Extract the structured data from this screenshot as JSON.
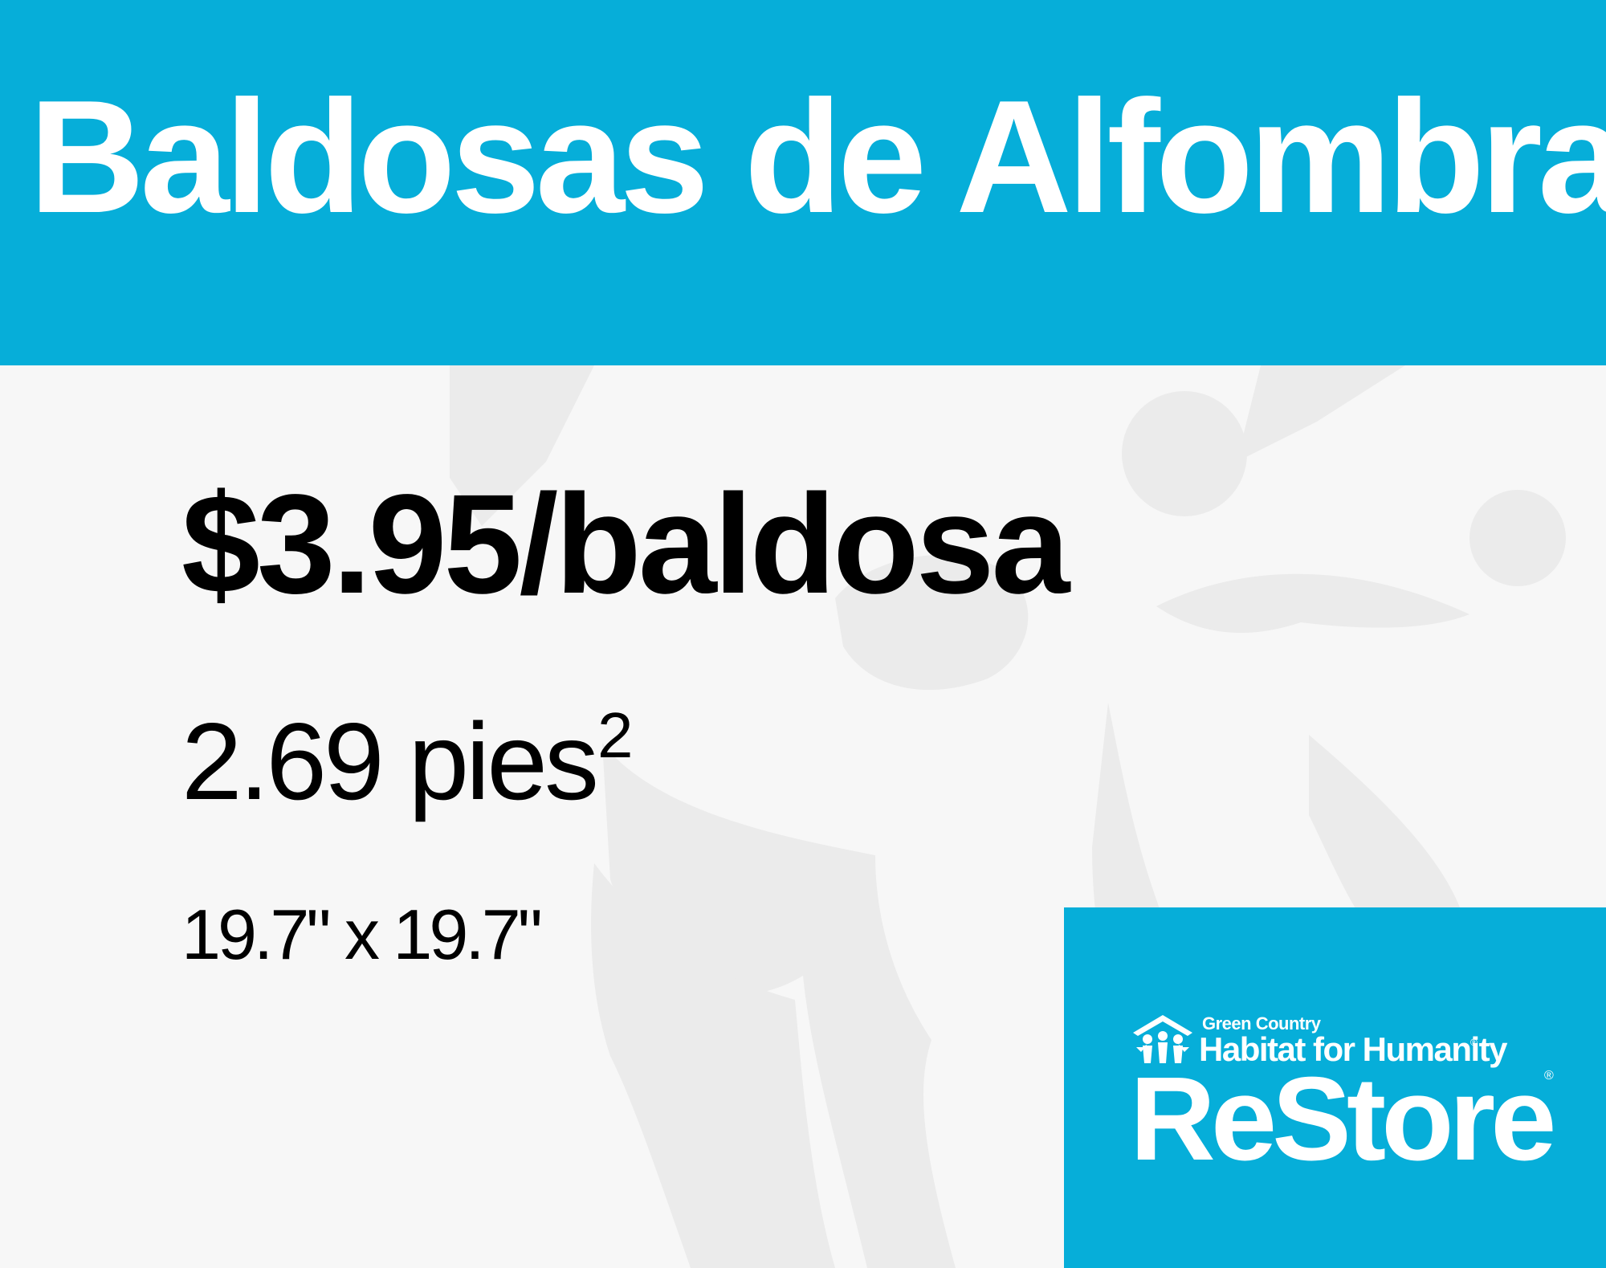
{
  "sign": {
    "title": "Baldosas de Alfombra",
    "price": "$3.95/baldosa",
    "area_value": "2.69 pies",
    "area_unit_sup": "2",
    "dimensions": "19.7\" x 19.7\""
  },
  "logo": {
    "org_line": "Green Country",
    "org_name": "Habitat for Humanity",
    "brand": "ReStore",
    "registered_mark": "®"
  },
  "colors": {
    "brand_blue": "#06aed9",
    "background": "#f7f7f7",
    "watermark": "#ececec",
    "text": "#000000",
    "logo_text": "#ffffff"
  },
  "icons": {
    "logo_emblem": "habitat-house-people-icon",
    "watermark": "habitat-people-watermark"
  }
}
